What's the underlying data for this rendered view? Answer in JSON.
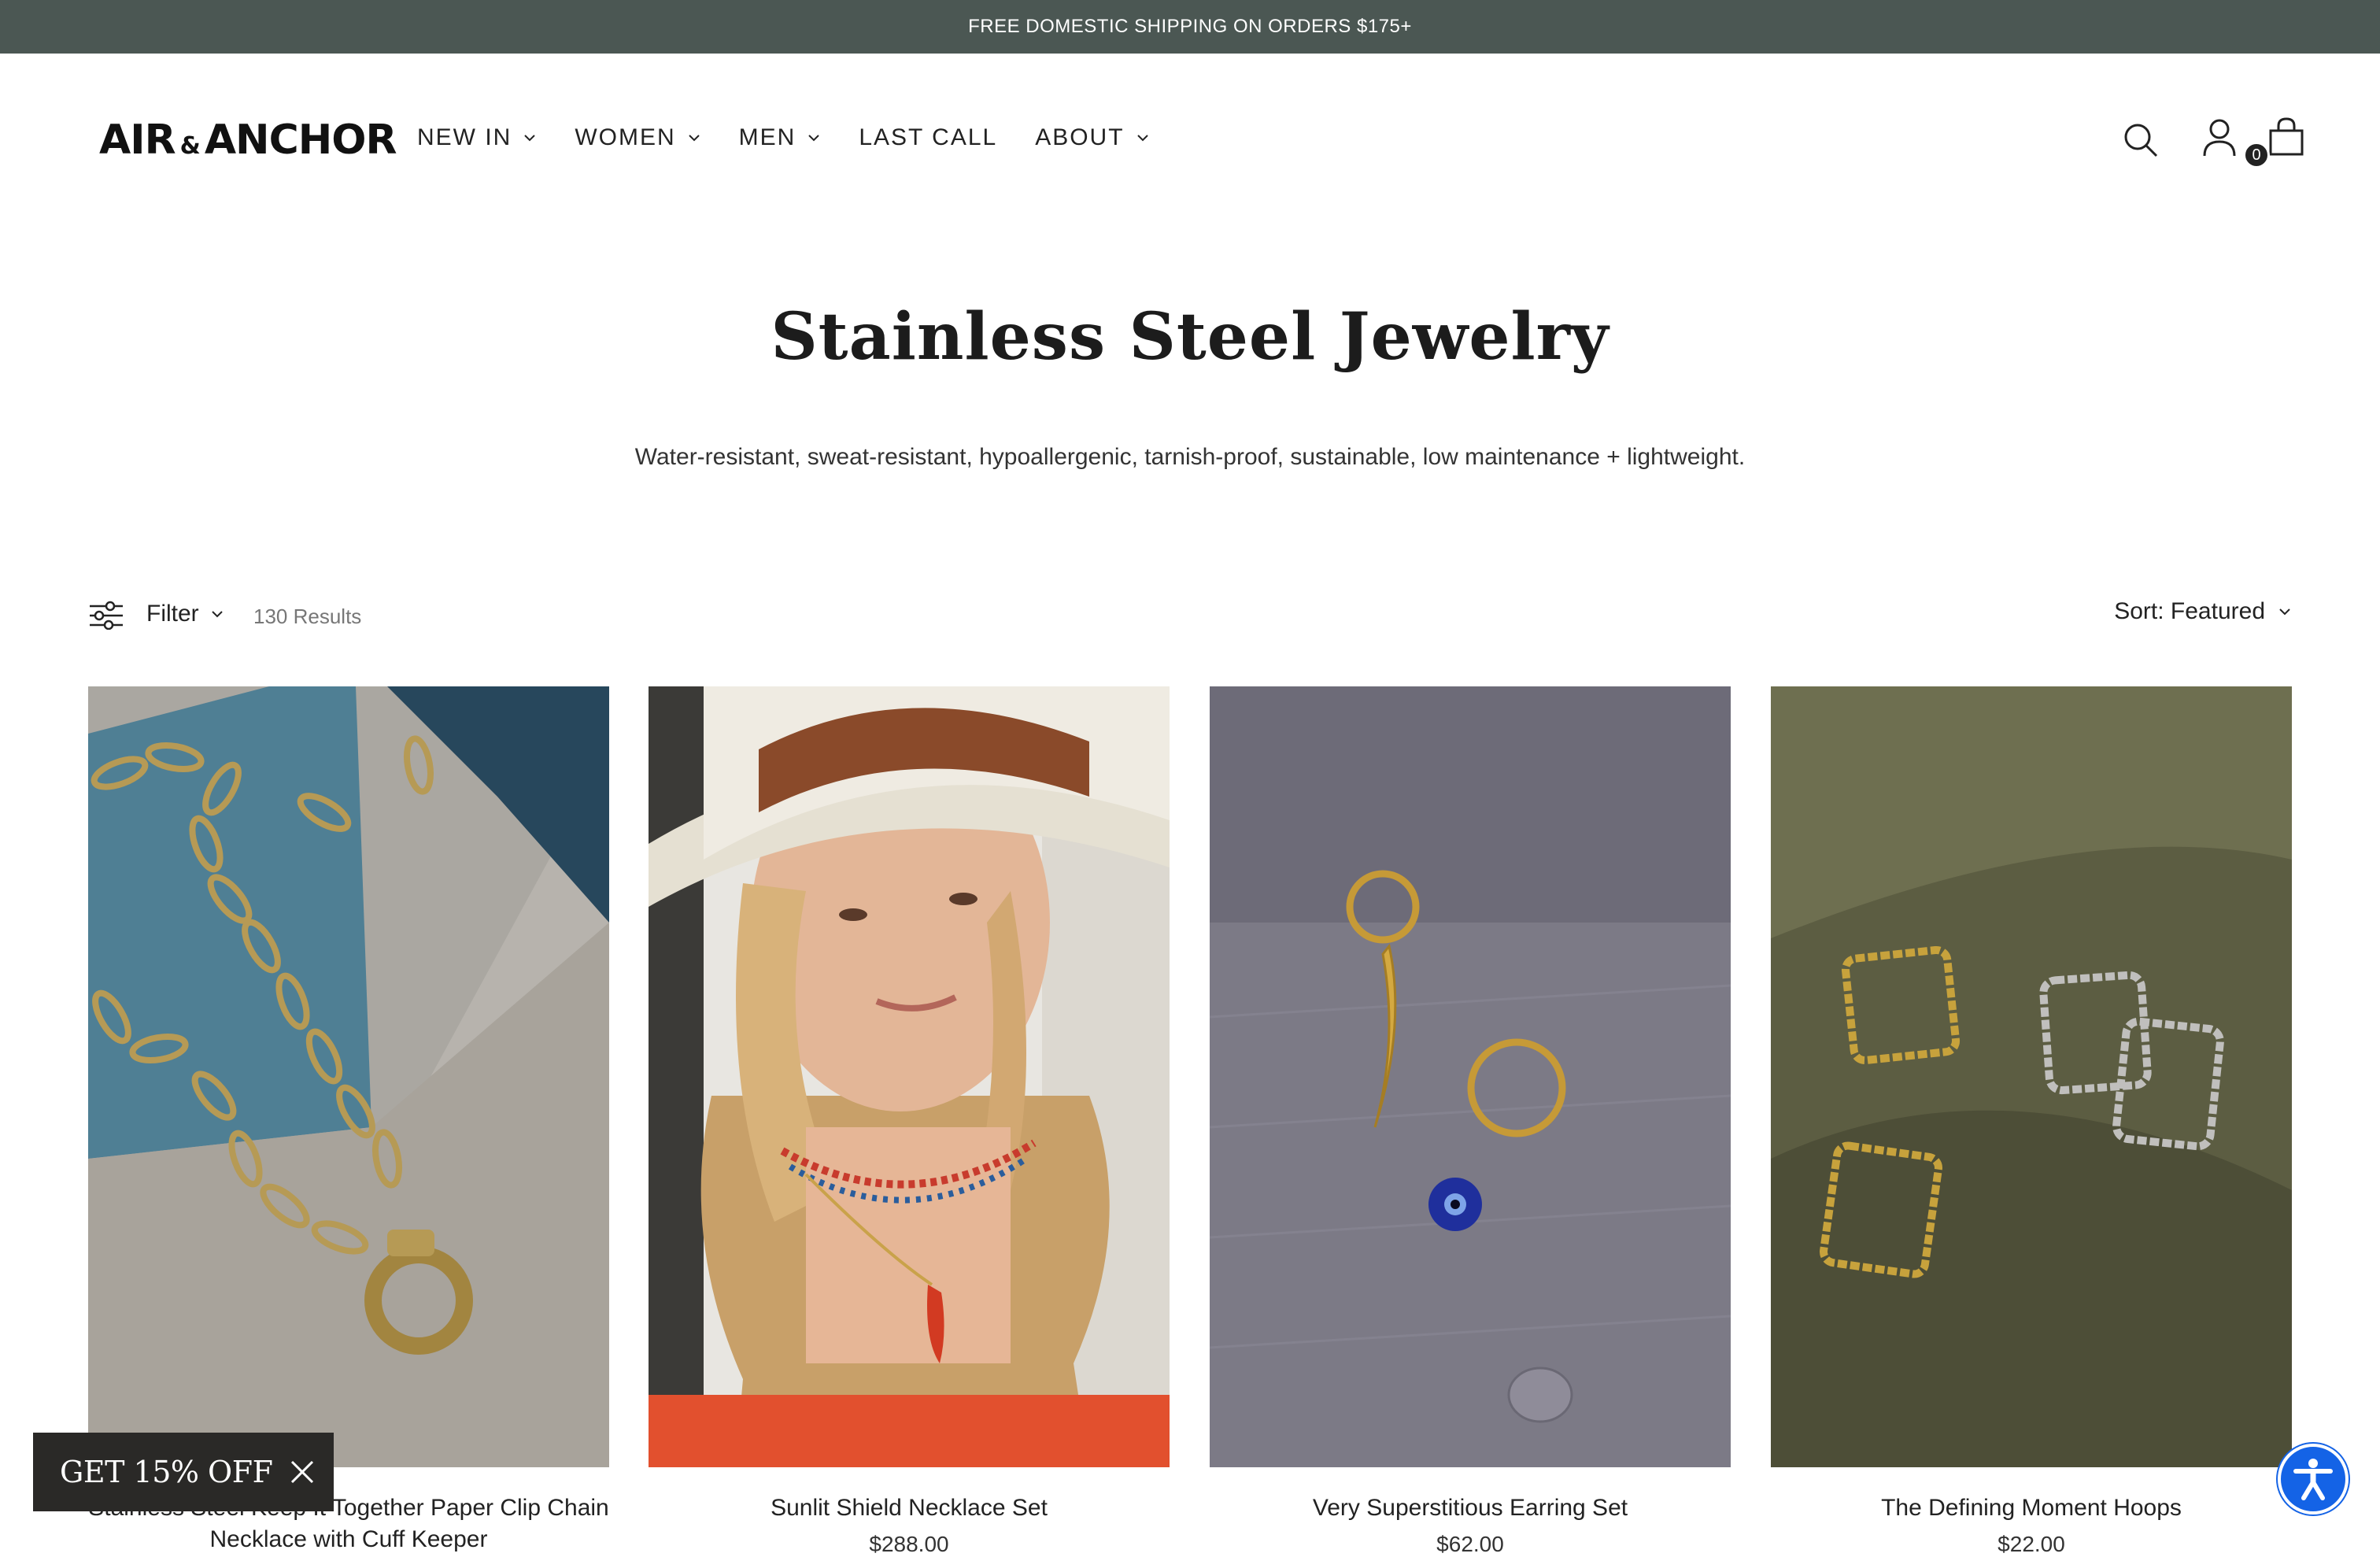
{
  "announcement": "FREE DOMESTIC SHIPPING ON ORDERS $175+",
  "brand": {
    "left": "AIR",
    "amp": "&",
    "right": "ANCHOR"
  },
  "nav": [
    {
      "label": "NEW IN",
      "dropdown": true
    },
    {
      "label": "WOMEN",
      "dropdown": true
    },
    {
      "label": "MEN",
      "dropdown": true
    },
    {
      "label": "LAST CALL",
      "dropdown": false
    },
    {
      "label": "ABOUT",
      "dropdown": true
    }
  ],
  "header_icons": [
    "search-icon",
    "account-icon",
    "cart-icon"
  ],
  "cart_count": "0",
  "page": {
    "title": "Stainless Steel Jewelry",
    "description": "Water-resistant, sweat-resistant, hypoallergenic, tarnish-proof, sustainable, low maintenance + lightweight."
  },
  "toolbar": {
    "filter_label": "Filter",
    "results": "130 Results",
    "sort_label": "Sort: Featured"
  },
  "products": [
    {
      "name": "Stainless Steel Keep It Together Paper Clip Chain Necklace with Cuff Keeper",
      "price": ""
    },
    {
      "name": "Sunlit Shield Necklace Set",
      "price": "$288.00"
    },
    {
      "name": "Very Superstitious Earring Set",
      "price": "$62.00"
    },
    {
      "name": "The Defining Moment Hoops",
      "price": "$22.00"
    }
  ],
  "promo": {
    "label": "GET 15% OFF"
  },
  "colors": {
    "announcement_bg": "#4b5753",
    "promo_bg": "#2a2927",
    "accessibility_blue": "#1463e6"
  }
}
